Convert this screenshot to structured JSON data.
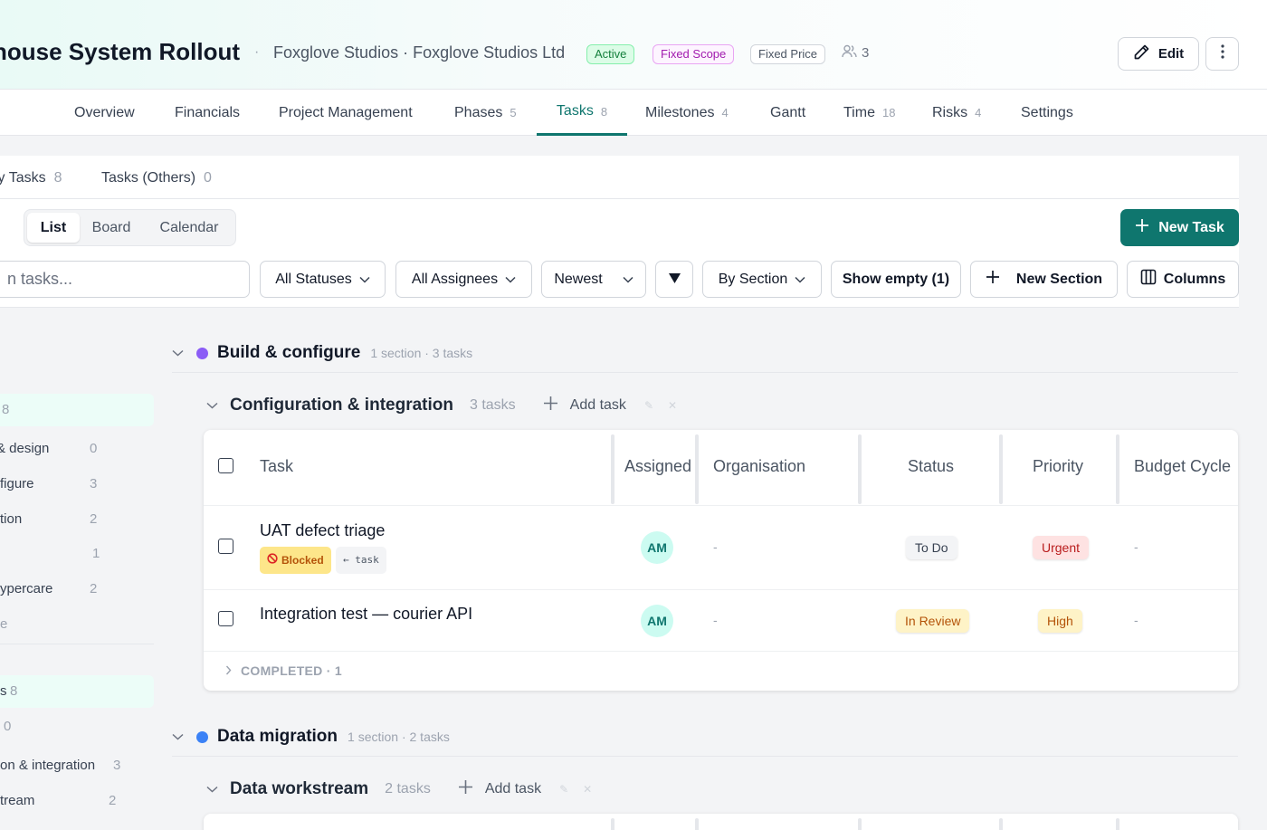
{
  "header": {
    "project_title": "house System Rollout",
    "separator": "·",
    "client": "Foxglove Studios · Foxglove Studios Ltd",
    "badges": {
      "active": "Active",
      "scope": "Fixed Scope",
      "price": "Fixed Price"
    },
    "member_count": "3",
    "edit_label": "Edit"
  },
  "nav": {
    "tabs": [
      {
        "label": "Overview",
        "count": ""
      },
      {
        "label": "Financials",
        "count": ""
      },
      {
        "label": "Project Management",
        "count": ""
      },
      {
        "label": "Phases",
        "count": "5"
      },
      {
        "label": "Tasks",
        "count": "8"
      },
      {
        "label": "Milestones",
        "count": "4"
      },
      {
        "label": "Gantt",
        "count": ""
      },
      {
        "label": "Time",
        "count": "18"
      },
      {
        "label": "Risks",
        "count": "4"
      },
      {
        "label": "Settings",
        "count": ""
      }
    ],
    "active": "Tasks"
  },
  "subtabs": [
    {
      "label": "ly Tasks",
      "count": "8"
    },
    {
      "label": "Tasks (Others)",
      "count": "0"
    }
  ],
  "views": {
    "list": "List",
    "board": "Board",
    "calendar": "Calendar",
    "active": "List"
  },
  "new_task_label": "New Task",
  "filters": {
    "search_placeholder": "n tasks...",
    "status": "All Statuses",
    "assignees": "All Assignees",
    "sort": "Newest",
    "group_by": "By Section",
    "show_empty": "Show empty (1)",
    "new_section": "New Section",
    "columns": "Columns"
  },
  "rail": {
    "group1": [
      {
        "label": "",
        "count": "8"
      },
      {
        "label": "& design",
        "count": "0"
      },
      {
        "label": "figure",
        "count": "3"
      },
      {
        "label": "tion",
        "count": "2"
      },
      {
        "label": "",
        "count": "1"
      },
      {
        "label": "ypercare",
        "count": "2"
      },
      {
        "label": "e",
        "count": ""
      }
    ],
    "group2": [
      {
        "label": "s",
        "count": "8"
      },
      {
        "label": "",
        "count": "0"
      },
      {
        "label": "on & integration",
        "count": "3"
      },
      {
        "label": "tream",
        "count": "2"
      }
    ]
  },
  "groups": [
    {
      "title": "Build & configure",
      "meta": "1 section · 3 tasks",
      "color": "#8b5cf6",
      "section": {
        "title": "Configuration & integration",
        "count": "3 tasks",
        "add_label": "Add task"
      }
    },
    {
      "title": "Data migration",
      "meta": "1 section · 2 tasks",
      "color": "#3b82f6",
      "section": {
        "title": "Data workstream",
        "count": "2 tasks",
        "add_label": "Add task"
      }
    }
  ],
  "table": {
    "columns": [
      "Task",
      "Assigned",
      "Organisation",
      "Status",
      "Priority",
      "Budget Cycle"
    ],
    "rows": [
      {
        "task": "UAT defect triage",
        "tags": {
          "blocked": "Blocked",
          "link": "← task"
        },
        "assignee": "AM",
        "organisation": "-",
        "status": "To Do",
        "priority": "Urgent",
        "budget_cycle": "-"
      },
      {
        "task": "Integration test — courier API",
        "assignee": "AM",
        "organisation": "-",
        "status": "In Review",
        "priority": "High",
        "budget_cycle": "-"
      }
    ],
    "completed_label": "COMPLETED · 1"
  },
  "colors": {
    "accent": "#0f766e",
    "group1_dot": "#8b5cf6",
    "group2_dot": "#3b82f6"
  }
}
